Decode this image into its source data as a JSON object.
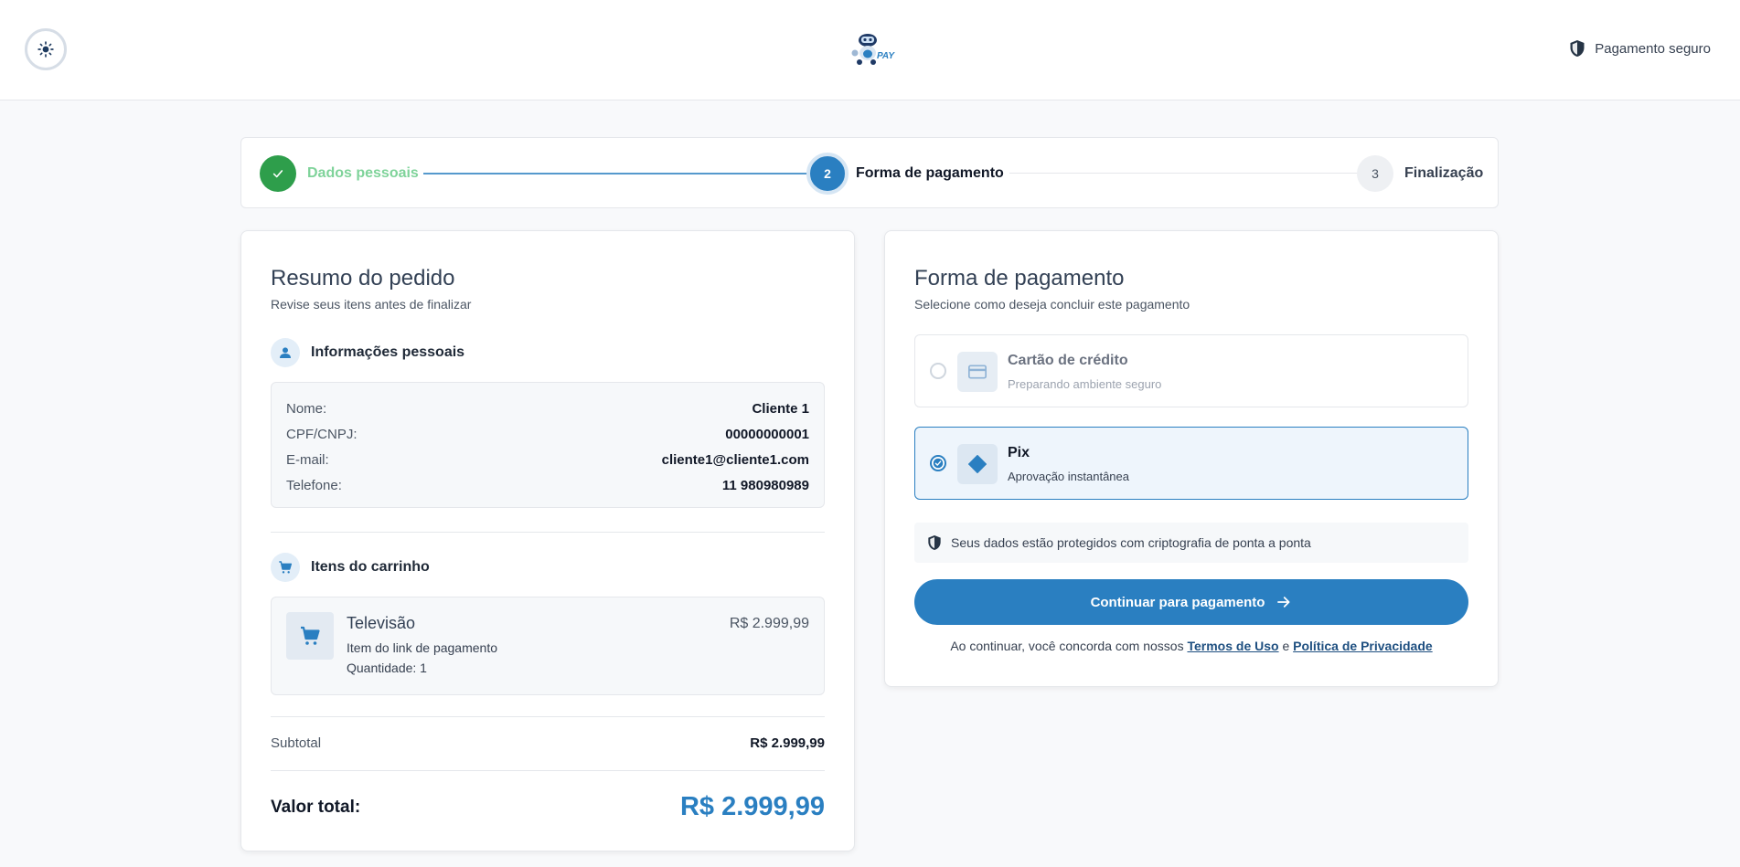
{
  "header": {
    "secure_label": "Pagamento seguro"
  },
  "stepper": {
    "steps": [
      {
        "number": "",
        "label": "Dados pessoais",
        "state": "done"
      },
      {
        "number": "2",
        "label": "Forma de pagamento",
        "state": "active"
      },
      {
        "number": "3",
        "label": "Finalização",
        "state": "pending"
      }
    ]
  },
  "summary": {
    "title": "Resumo do pedido",
    "subtitle": "Revise seus itens antes de finalizar",
    "personal": {
      "title": "Informações pessoais",
      "rows": [
        {
          "key": "Nome:",
          "value": "Cliente 1"
        },
        {
          "key": "CPF/CNPJ:",
          "value": "00000000001"
        },
        {
          "key": "E-mail:",
          "value": "cliente1@cliente1.com"
        },
        {
          "key": "Telefone:",
          "value": "11 980980989"
        }
      ]
    },
    "cart": {
      "title": "Itens do carrinho",
      "item": {
        "name": "Televisão",
        "description": "Item do link de pagamento",
        "quantity": "Quantidade: 1",
        "price": "R$ 2.999,99"
      }
    },
    "subtotal_label": "Subtotal",
    "subtotal_value": "R$ 2.999,99",
    "total_label": "Valor total:",
    "total_value": "R$ 2.999,99"
  },
  "payment": {
    "title": "Forma de pagamento",
    "subtitle": "Selecione como deseja concluir este pagamento",
    "options": [
      {
        "name": "Cartão de crédito",
        "description": "Preparando ambiente seguro",
        "selected": false
      },
      {
        "name": "Pix",
        "description": "Aprovação instantânea",
        "selected": true
      }
    ],
    "secure_note": "Seus dados estão protegidos com criptografia de ponta a ponta",
    "continue_label": "Continuar para pagamento",
    "terms_prefix": "Ao continuar, você concorda com nossos",
    "terms_link": "Termos de Uso",
    "terms_and": "e",
    "privacy_link": "Política de Privacidade"
  },
  "colors": {
    "accent": "#2a7fc1",
    "success": "#2e9e4b",
    "success_text": "#7fd39a",
    "total": "#2a7fc1"
  },
  "icons": {
    "theme": "sun-icon",
    "secure": "shield-icon",
    "user": "user-icon",
    "cart": "cart-icon",
    "card": "credit-card-icon",
    "pix": "pix-icon",
    "arrow": "arrow-right-icon",
    "check": "check-icon"
  }
}
